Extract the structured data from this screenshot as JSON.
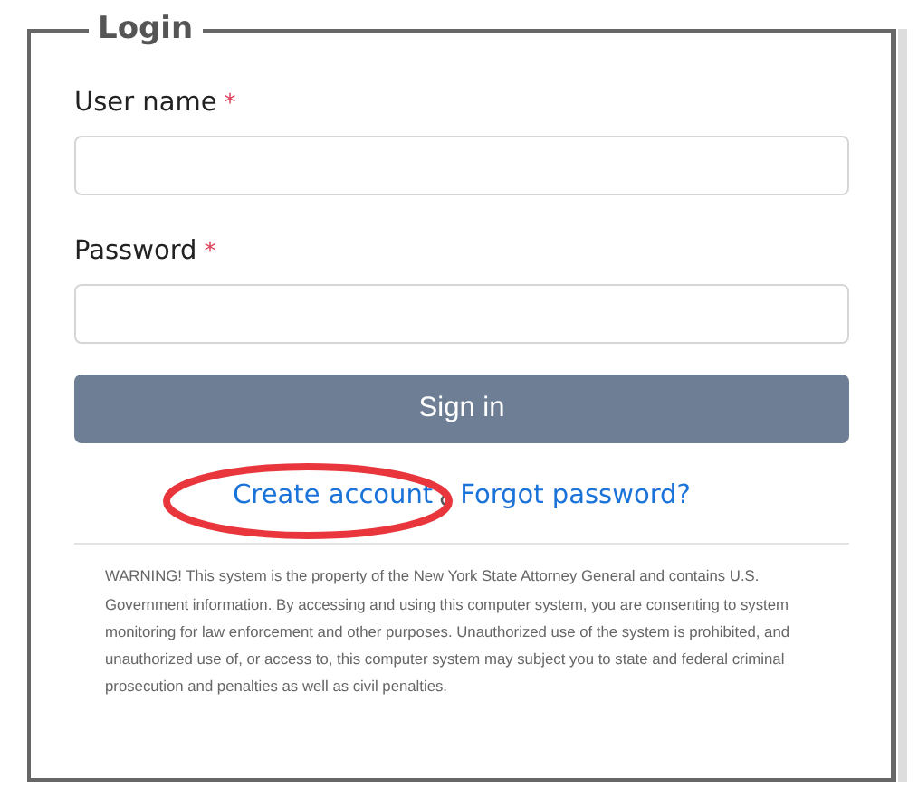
{
  "form": {
    "legend": "Login",
    "fields": [
      {
        "label": "User name",
        "required_mark": "*"
      },
      {
        "label": "Password",
        "required_mark": "*"
      }
    ],
    "submit": "Sign in",
    "links": [
      "Create account",
      "Forgot password?"
    ],
    "warning": "WARNING! This system is the property of the New York State Attorney General and contains U.S. Government information. By accessing and using this computer system, you are consenting to system monitoring for law enforcement and other purposes. Unauthorized use of the system is prohibited, and unauthorized use of, or access to, this computer system may subject you to state and federal criminal prosecution and penalties as well as civil penalties."
  }
}
